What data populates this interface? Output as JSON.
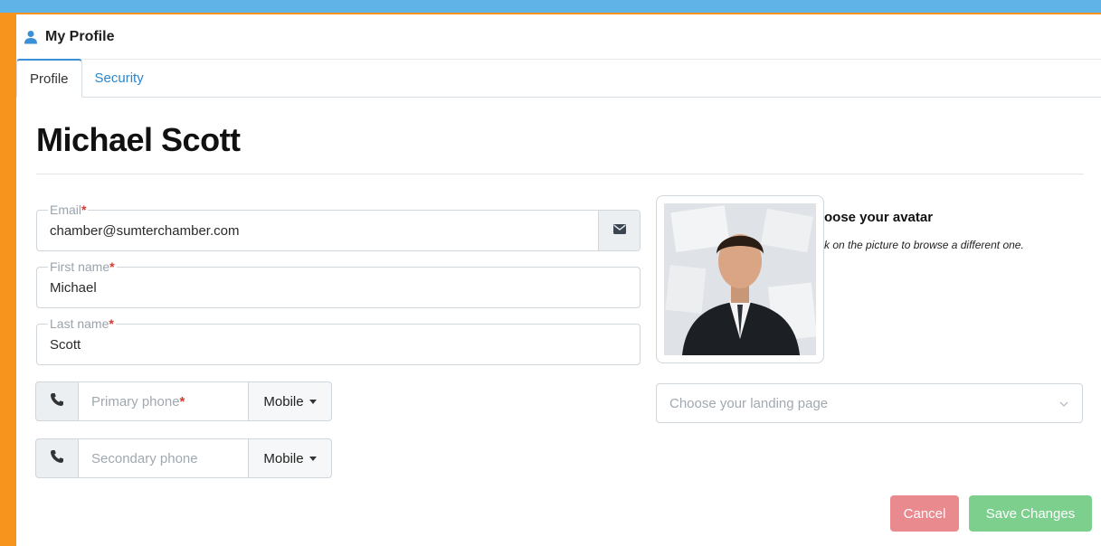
{
  "header": {
    "title": "My Profile"
  },
  "tabs": [
    {
      "label": "Profile"
    },
    {
      "label": "Security"
    }
  ],
  "profile": {
    "name": "Michael Scott"
  },
  "fields": {
    "email": {
      "label": "Email",
      "required": "*",
      "value": "chamber@sumterchamber.com"
    },
    "first_name": {
      "label": "First name",
      "required": "*",
      "value": "Michael"
    },
    "last_name": {
      "label": "Last name",
      "required": "*",
      "value": "Scott"
    }
  },
  "phones": {
    "primary": {
      "placeholder": "Primary phone",
      "required": "*",
      "type": "Mobile"
    },
    "secondary": {
      "placeholder": "Secondary phone",
      "type": "Mobile"
    }
  },
  "avatar": {
    "title": "oose your avatar",
    "help": "k on the picture to browse a different one."
  },
  "landing_page": {
    "placeholder": "Choose your landing page"
  },
  "actions": {
    "cancel": "Cancel",
    "save": "Save Changes"
  },
  "colors": {
    "frame_orange": "#f7941d",
    "background_blue": "#5fb3e6",
    "tab_accent": "#3a8fd6",
    "cancel": "#e98a8f",
    "save": "#7dcf8d",
    "required": "#d9382f"
  }
}
